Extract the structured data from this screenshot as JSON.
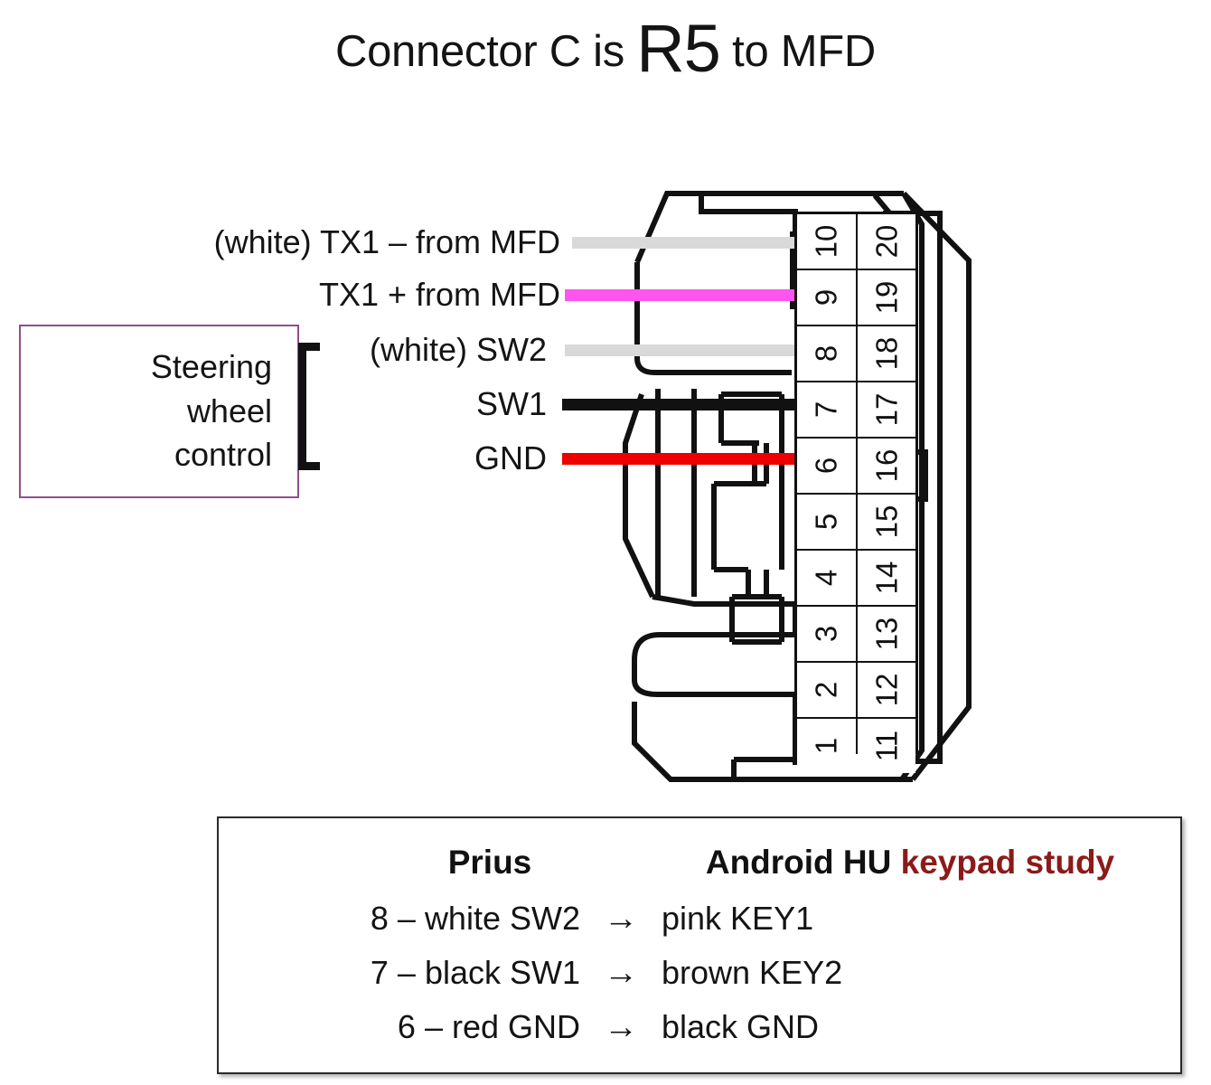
{
  "title": {
    "prefix": "Connector C is ",
    "emphasis": "R5",
    "suffix": " to MFD"
  },
  "wires": [
    {
      "label": "(white) TX1 – from MFD",
      "color": "#D9D9D9",
      "pin": 10,
      "name": "wire-tx1-minus"
    },
    {
      "label": "TX1 + from MFD",
      "color": "#FF55EE",
      "pin": 9,
      "name": "wire-tx1-plus"
    },
    {
      "label": "(white) SW2",
      "color": "#D9D9D9",
      "pin": 8,
      "name": "wire-sw2"
    },
    {
      "label": "SW1",
      "color": "#111111",
      "pin": 7,
      "name": "wire-sw1"
    },
    {
      "label": "GND",
      "color": "#EE0000",
      "pin": 6,
      "name": "wire-gnd"
    }
  ],
  "steering_group": {
    "box_text": "Steering\nwheel\ncontrol",
    "border_color": "#8E4E8E"
  },
  "pin_grid": {
    "left_column": [
      "10",
      "9",
      "8",
      "7",
      "6",
      "5",
      "4",
      "3",
      "2",
      "1"
    ],
    "right_column": [
      "20",
      "19",
      "18",
      "17",
      "16",
      "15",
      "14",
      "13",
      "12",
      "11"
    ]
  },
  "legend": {
    "header_left": "Prius",
    "header_right_plain": "Android HU ",
    "header_right_accent": "keypad study",
    "accent_color": "#8C1A1A",
    "rows": [
      {
        "left": "8 – white SW2",
        "arrow": "→",
        "right": "pink KEY1"
      },
      {
        "left": "7 – black SW1",
        "arrow": "→",
        "right": "brown KEY2"
      },
      {
        "left": "6 – red GND",
        "arrow": "→",
        "right": "black GND"
      }
    ]
  }
}
